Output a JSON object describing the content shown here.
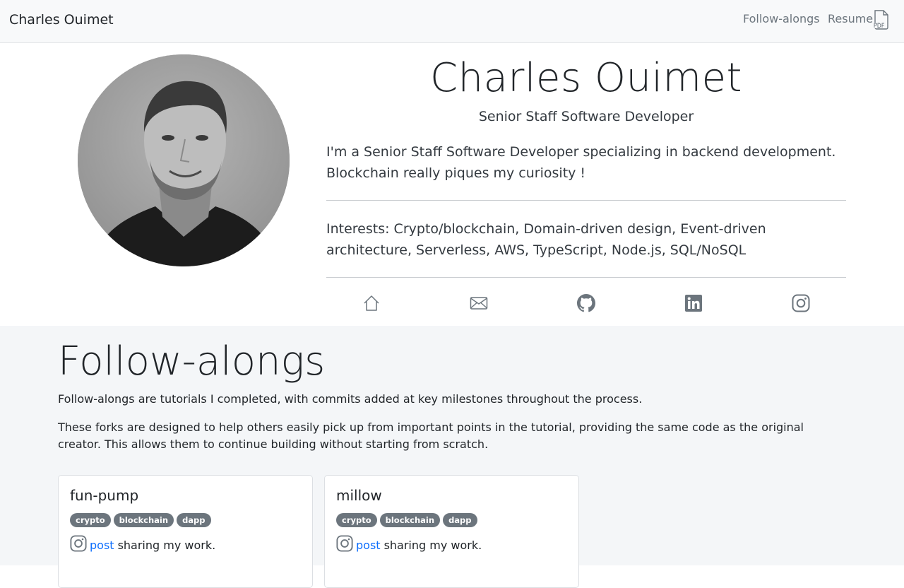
{
  "navbar": {
    "brand": "Charles Ouimet",
    "links": {
      "follow_alongs": "Follow-alongs",
      "resume": "Resume"
    },
    "resume_icon": "pdf-file-icon"
  },
  "profile": {
    "name": "Charles Ouimet",
    "title": "Senior Staff Software Developer",
    "bio": "I'm a Senior Staff Software Developer specializing in backend development. Blockchain really piques my curiosity !",
    "interests": "Interests: Crypto/blockchain, Domain-driven design, Event-driven architecture, Serverless, AWS, TypeScript, Node.js, SQL/NoSQL",
    "social_icons": [
      "home-icon",
      "mail-icon",
      "github-icon",
      "linkedin-icon",
      "instagram-icon"
    ]
  },
  "follow_alongs": {
    "heading": "Follow-alongs",
    "intro": "Follow-alongs are tutorials I completed, with commits added at key milestones throughout the process.",
    "description": "These forks are designed to help others easily pick up from important points in the tutorial, providing the same code as the original creator. This allows them to continue building without starting from scratch.",
    "cards": [
      {
        "title": "fun-pump",
        "tags": [
          "crypto",
          "blockchain",
          "dapp"
        ],
        "post_link": "post",
        "post_text": "sharing my work."
      },
      {
        "title": "millow",
        "tags": [
          "crypto",
          "blockchain",
          "dapp"
        ],
        "post_link": "post",
        "post_text": "sharing my work."
      }
    ]
  },
  "colors": {
    "navbar_bg": "#f8f9fa",
    "section_bg": "#f4f6f8",
    "badge_bg": "#6c757d",
    "link": "#0d6efd",
    "icon": "#6c757d"
  }
}
